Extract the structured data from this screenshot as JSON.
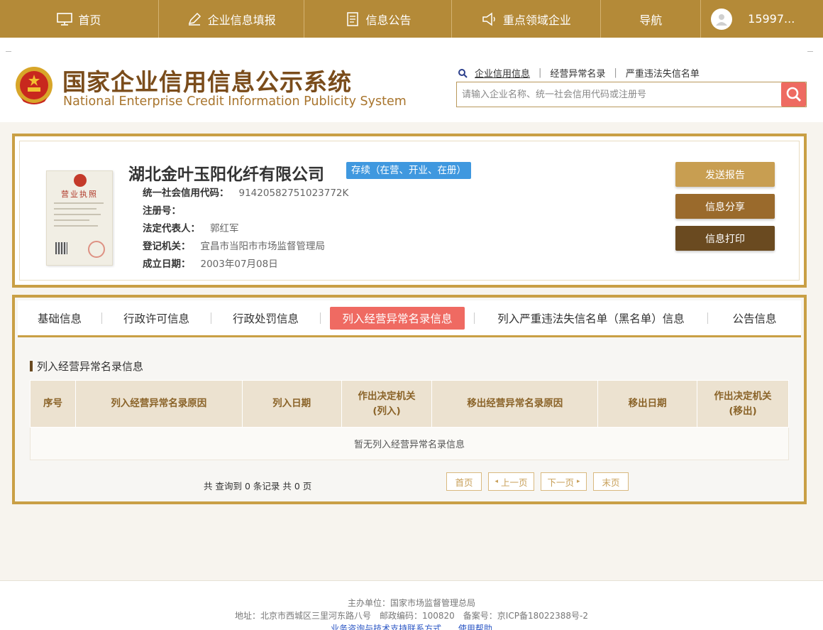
{
  "nav": {
    "items": [
      {
        "label": "首页",
        "icon": "monitor-icon"
      },
      {
        "label": "企业信息填报",
        "icon": "edit-icon"
      },
      {
        "label": "信息公告",
        "icon": "document-icon"
      },
      {
        "label": "重点领域企业",
        "icon": "megaphone-icon"
      },
      {
        "label": "导航",
        "icon": ""
      }
    ],
    "user": "15997..."
  },
  "header": {
    "title_cn": "国家企业信用信息公示系统",
    "title_en": "National Enterprise Credit Information Publicity System",
    "search_links": [
      "企业信用信息",
      "经营异常名录",
      "严重违法失信名单"
    ],
    "search_placeholder": "请输入企业名称、统一社会信用代码或注册号"
  },
  "company": {
    "license_title": "营业执照",
    "name": "湖北金叶玉阳化纤有限公司",
    "status": "存续（在营、开业、在册）",
    "fields": [
      {
        "label": "统一社会信用代码：",
        "value": "91420582751023772K"
      },
      {
        "label": "注册号：",
        "value": ""
      },
      {
        "label": "法定代表人：",
        "value": "郭红军"
      },
      {
        "label": "登记机关：",
        "value": "宜昌市当阳市市场监督管理局"
      },
      {
        "label": "成立日期：",
        "value": "2003年07月08日"
      }
    ],
    "buttons": {
      "send": "发送报告",
      "share": "信息分享",
      "print": "信息打印"
    }
  },
  "tabs": [
    "基础信息",
    "行政许可信息",
    "行政处罚信息",
    "列入经营异常名录信息",
    "列入严重违法失信名单（黑名单）信息",
    "公告信息"
  ],
  "active_tab": "列入经营异常名录信息",
  "section": {
    "title": "列入经营异常名录信息",
    "table_headers": [
      "序号",
      "列入经营异常名录原因",
      "列入日期",
      "作出决定机关(列入)",
      "移出经营异常名录原因",
      "移出日期",
      "作出决定机关(移出)"
    ],
    "table_headers_line1": [
      "序号",
      "列入经营异常名录原因",
      "列入日期",
      "作出决定机关",
      "移出经营异常名录原因",
      "移出日期",
      "作出决定机关"
    ],
    "table_headers_line2": [
      "",
      "",
      "",
      "(列入)",
      "",
      "",
      "(移出)"
    ],
    "empty_text": "暂无列入经营异常名录信息",
    "pager_info": "共 查询到 0 条记录 共 0 页",
    "pager": {
      "first": "首页",
      "prev": "上一页",
      "next": "下一页",
      "last": "末页"
    }
  },
  "footer": {
    "line1": "主办单位：国家市场监督管理总局",
    "line2": "地址：北京市西城区三里河东路八号　邮政编码：100820　备案号：京ICP备18022388号-2",
    "link1": "业务咨询与技术支持联系方式",
    "link2": "使用帮助"
  },
  "colors": {
    "gold": "#b48a38",
    "accent_red": "#ef6a62",
    "badge_blue": "#3f98df"
  }
}
